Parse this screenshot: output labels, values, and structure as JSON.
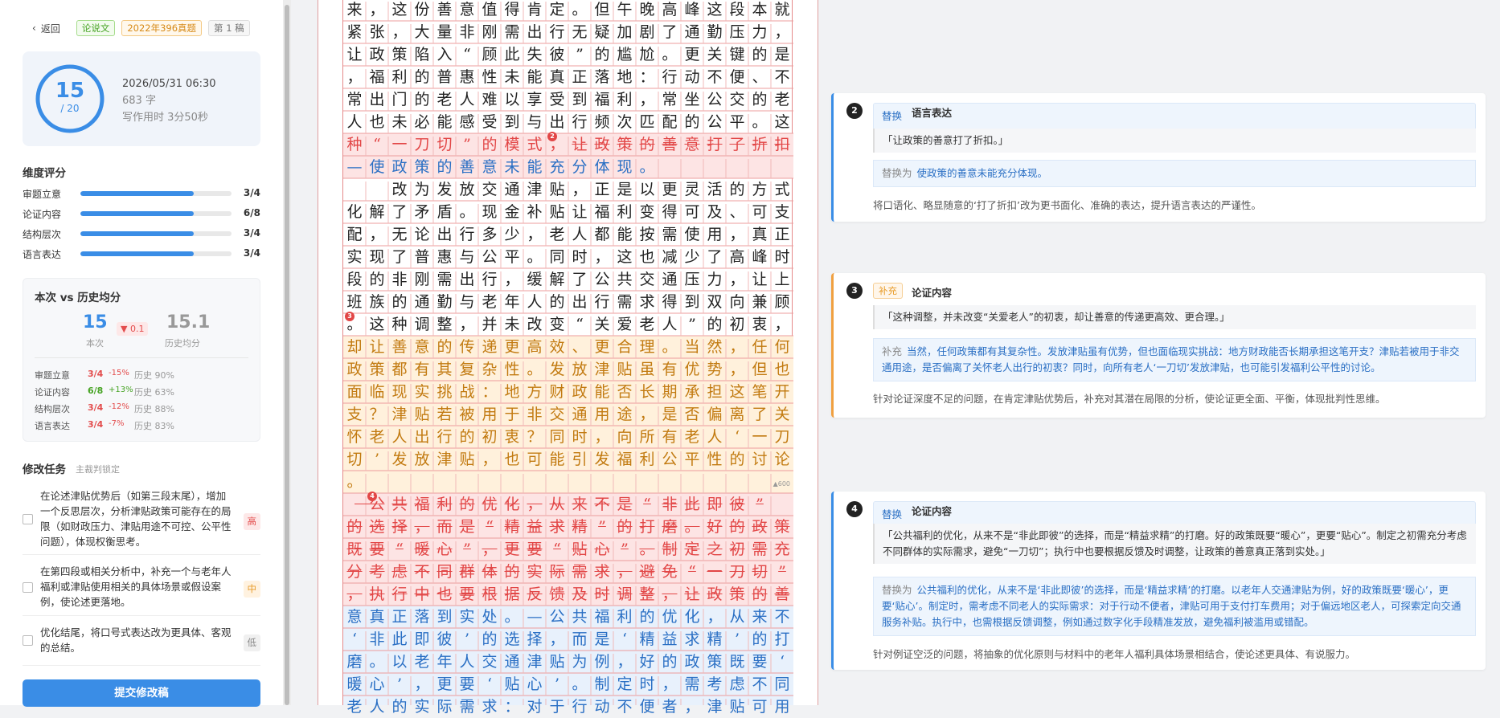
{
  "topbar": {
    "back": "返回",
    "tags": [
      "论说文",
      "2022年396真题",
      "第 1 稿"
    ]
  },
  "score": {
    "value": "15",
    "total": "/ 20",
    "date": "2026/05/31 06:30",
    "words": "683 字",
    "time": "写作用时 3分50秒",
    "progress": 0.75
  },
  "dimensions": {
    "title": "维度评分",
    "items": [
      {
        "label": "审题立意",
        "value": "3/4",
        "ratio": 0.75
      },
      {
        "label": "论证内容",
        "value": "6/8",
        "ratio": 0.75
      },
      {
        "label": "结构层次",
        "value": "3/4",
        "ratio": 0.75
      },
      {
        "label": "语言表达",
        "value": "3/4",
        "ratio": 0.75
      }
    ]
  },
  "compare": {
    "title": "本次 vs 历史均分",
    "current": "15",
    "current_label": "本次",
    "delta": "▼ 0.1",
    "avg": "15.1",
    "avg_label": "历史均分",
    "rows": [
      {
        "label": "审题立意",
        "score": "3/4",
        "change": "-15%",
        "hist": "历史 90%"
      },
      {
        "label": "论证内容",
        "score": "6/8",
        "change": "+13%",
        "hist": "历史 63%"
      },
      {
        "label": "结构层次",
        "score": "3/4",
        "change": "-12%",
        "hist": "历史 88%"
      },
      {
        "label": "语言表达",
        "score": "3/4",
        "change": "-7%",
        "hist": "历史 83%"
      }
    ]
  },
  "tasks": {
    "title": "修改任务",
    "subtitle": "主裁判锁定",
    "items": [
      {
        "text": "在论述津贴优势后（如第三段末尾），增加一个反思层次，分析津贴政策可能存在的局限（如财政压力、津贴用途不可控、公平性问题），体现权衡思考。",
        "priority": "高"
      },
      {
        "text": "在第四段或相关分析中，补充一个与老年人福利或津贴使用相关的具体场景或假设案例，使论述更落地。",
        "priority": "中"
      },
      {
        "text": "优化结尾，将口号式表达改为更具体、客观的总结。",
        "priority": "低"
      }
    ],
    "submit": "提交修改稿"
  },
  "paper": {
    "rows": [
      "来，这份善意值得肯定。但午晚高峰这段本就",
      "紧张，大量非刚需出行无疑加剧了通勤压力，",
      "让政策陷入“顾此失彼”的尴尬。更关键的是",
      "，福利的普惠性未能真正落地：行动不便、不",
      "常出门的老人难以享受到福利，常坐公交的老",
      "人也未必能感受到与出行频次匹配的公平。这",
      "种“一刀切”的模式，让政策的善意打了折扣",
      "—使政策的善意未能充分体现。",
      "　　改为发放交通津贴，正是以更灵活的方式",
      "化解了矛盾。现金补贴让福利变得可及、可支",
      "配，无论出行多少，老人都能按需使用，真正",
      "实现了普惠与公平。同时，这也减少了高峰时",
      "段的非刚需出行，缓解了公共交通压力，让上",
      "班族的通勤与老年人的出行需求得到双向兼顾",
      "。这种调整，并未改变“关爱老人”的初衷，",
      "却让善意的传递更高效、更合理。当然，任何",
      "政策都有其复杂性。发放津贴虽有优势，但也",
      "面临现实挑战：地方财政能否长期承担这笔开",
      "支？津贴若被用于非交通用途，是否偏离了关",
      "怀老人出行的初衷？同时，向所有老人‘一刀",
      "切’发放津贴，也可能引发福利公平性的讨论",
      "。",
      "　公共福利的优化，从来不是“非此即彼”",
      "的选择，而是“精益求精”的打磨。好的政策",
      "既要“暖心”，更要“贴心”。制定之初需充",
      "分考虑不同群体的实际需求，避免“一刀切”",
      "，执行中也要根据反馈及时调整，让政策的善",
      "意真正落到实处。—公共福利的优化，从来不是",
      "‘非此即彼’的选择，而是‘精益求精’的打",
      "磨。以老年人交通津贴为例，好的政策既要‘",
      "暖心’，更要‘贴心’。制定时，需考虑不同",
      "老人的实际需求：对于行动不便者，津贴可用"
    ],
    "marks": [
      "2",
      "3",
      "4"
    ],
    "counter": "▲600"
  },
  "cards": [
    {
      "no": "2",
      "badge": "替换",
      "title": "语言表达",
      "original": "「让政策的善意打了折扣。」",
      "prefix": "替换为",
      "replacement": "使政策的善意未能充分体现。",
      "note": "将口语化、略显随意的‘打了折扣’改为更书面化、准确的表达，提升语言表达的严谨性。"
    },
    {
      "no": "3",
      "badge": "补充",
      "title": "论证内容",
      "original": "「这种调整，并未改变“关爱老人”的初衷，却让善意的传递更高效、更合理。」",
      "prefix": "补充",
      "replacement": "当然，任何政策都有其复杂性。发放津贴虽有优势，但也面临现实挑战：地方财政能否长期承担这笔开支？津贴若被用于非交通用途，是否偏离了关怀老人出行的初衷？同时，向所有老人‘一刀切’发放津贴，也可能引发福利公平性的讨论。",
      "note": "针对论证深度不足的问题，在肯定津贴优势后，补充对其潜在局限的分析，使论证更全面、平衡，体现批判性思维。"
    },
    {
      "no": "4",
      "badge": "替换",
      "title": "论证内容",
      "original": "「公共福利的优化，从来不是“非此即彼”的选择，而是“精益求精”的打磨。好的政策既要“暖心”，更要“贴心”。制定之初需充分考虑不同群体的实际需求，避免“一刀切”；执行中也要根据反馈及时调整，让政策的善意真正落到实处。」",
      "prefix": "替换为",
      "replacement": "公共福利的优化，从来不是‘非此即彼’的选择，而是‘精益求精’的打磨。以老年人交通津贴为例，好的政策既要‘暖心’，更要‘贴心’。制定时，需考虑不同老人的实际需求：对于行动不便者，津贴可用于支付打车费用；对于偏远地区老人，可探索定向交通服务补贴。执行中，也需根据反馈调整，例如通过数字化手段精准发放，避免福利被滥用或错配。",
      "note": "针对例证空泛的问题，将抽象的优化原则与材料中的老年人福利具体场景相结合，使论述更具体、有说服力。"
    }
  ]
}
